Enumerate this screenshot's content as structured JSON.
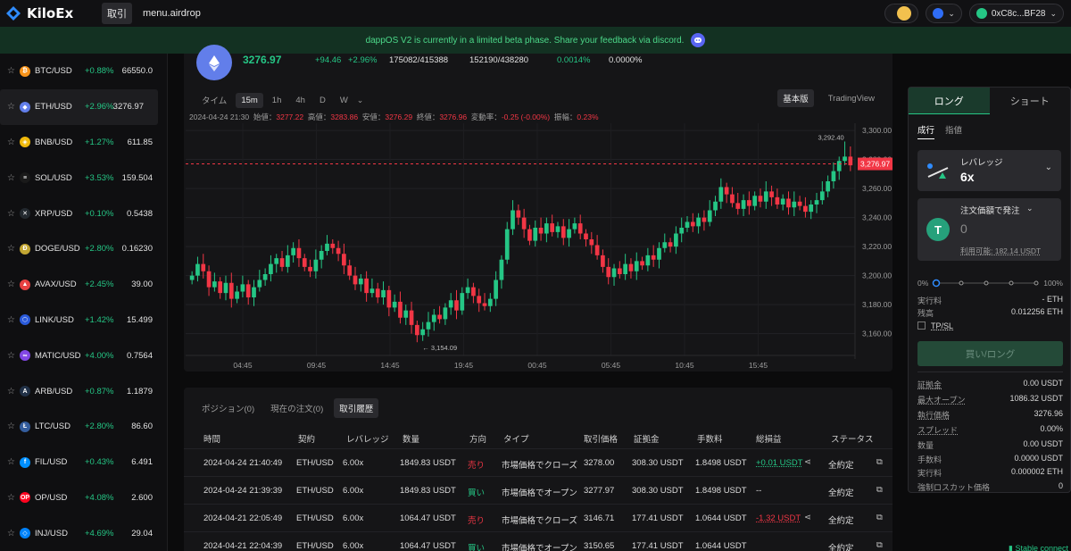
{
  "header": {
    "logo": "KiloEx",
    "nav_active": "取引",
    "nav_link": "menu.airdrop",
    "wallet": "0xC8c...BF28"
  },
  "banner": {
    "text": "dappOS V2 is currently in a limited beta phase. Share your feedback via discord."
  },
  "markets": [
    {
      "pair": "BTC/USD",
      "change": "+0.88%",
      "price": "66550.0",
      "color": "#f7931a",
      "glyph": "₿"
    },
    {
      "pair": "ETH/USD",
      "change": "+2.96%",
      "price": "3276.97",
      "color": "#627eea",
      "glyph": "◆"
    },
    {
      "pair": "BNB/USD",
      "change": "+1.27%",
      "price": "611.85",
      "color": "#f0b90b",
      "glyph": "◈"
    },
    {
      "pair": "SOL/USD",
      "change": "+3.53%",
      "price": "159.504",
      "color": "#1a1a1a",
      "glyph": "≡"
    },
    {
      "pair": "XRP/USD",
      "change": "+0.10%",
      "price": "0.5438",
      "color": "#23292f",
      "glyph": "✕"
    },
    {
      "pair": "DOGE/USD",
      "change": "+2.80%",
      "price": "0.16230",
      "color": "#c2a633",
      "glyph": "Ð"
    },
    {
      "pair": "AVAX/USD",
      "change": "+2.45%",
      "price": "39.00",
      "color": "#e84142",
      "glyph": "▲"
    },
    {
      "pair": "LINK/USD",
      "change": "+1.42%",
      "price": "15.499",
      "color": "#2a5ada",
      "glyph": "⬡"
    },
    {
      "pair": "MATIC/USD",
      "change": "+4.00%",
      "price": "0.7564",
      "color": "#8247e5",
      "glyph": "∞"
    },
    {
      "pair": "ARB/USD",
      "change": "+0.87%",
      "price": "1.1879",
      "color": "#213147",
      "glyph": "A"
    },
    {
      "pair": "LTC/USD",
      "change": "+2.80%",
      "price": "86.60",
      "color": "#345d9d",
      "glyph": "Ł"
    },
    {
      "pair": "FIL/USD",
      "change": "+0.43%",
      "price": "6.491",
      "color": "#0090ff",
      "glyph": "f"
    },
    {
      "pair": "OP/USD",
      "change": "+4.08%",
      "price": "2.600",
      "color": "#ff0420",
      "glyph": "OP"
    },
    {
      "pair": "INJ/USD",
      "change": "+4.69%",
      "price": "29.04",
      "color": "#0082fa",
      "glyph": "◇"
    }
  ],
  "ticker": {
    "price": "3276.97",
    "change_abs": "+94.46",
    "change_pct": "+2.96%",
    "oi_long": "175082/415388",
    "oi_short": "152190/438280",
    "funding": "0.0014%",
    "borrow": "0.0000%"
  },
  "chart_toolbar": {
    "intervals": [
      "タイム",
      "15m",
      "1h",
      "4h",
      "D",
      "W"
    ],
    "mode_basic": "基本版",
    "mode_tv": "TradingView"
  },
  "ohlc": {
    "time": "2024-04-24 21:30",
    "open_label": "始値：",
    "open": "3277.22",
    "high_label": "高値：",
    "high": "3283.86",
    "low_label": "安値：",
    "low": "3276.29",
    "close_label": "終値：",
    "close": "3276.96",
    "chg_label": "変動率：",
    "chg": "-0.25 (-0.00%)",
    "amp_label": "振幅：",
    "amp": "0.23%"
  },
  "chart_data": {
    "type": "candlestick",
    "ylim": [
      3145,
      3305
    ],
    "y_ticks": [
      "3,300.00",
      "3,280.00",
      "3,260.00",
      "3,240.00",
      "3,220.00",
      "3,200.00",
      "3,180.00",
      "3,160.00"
    ],
    "x_ticks": [
      "04:45",
      "09:45",
      "14:45",
      "19:45",
      "00:45",
      "05:45",
      "10:45",
      "15:45"
    ],
    "current_price_label": "3,276.97",
    "current_price": 3276.97,
    "high_marker": "3,292.40",
    "high_value": 3292.4,
    "low_marker": "3,154.09",
    "low_value": 3154.09,
    "closes": [
      3200,
      3208,
      3203,
      3192,
      3196,
      3188,
      3195,
      3184,
      3189,
      3194,
      3185,
      3192,
      3197,
      3201,
      3208,
      3212,
      3206,
      3214,
      3219,
      3212,
      3206,
      3203,
      3211,
      3217,
      3222,
      3219,
      3215,
      3207,
      3200,
      3194,
      3198,
      3188,
      3191,
      3185,
      3190,
      3178,
      3182,
      3171,
      3176,
      3166,
      3159,
      3163,
      3168,
      3173,
      3170,
      3178,
      3183,
      3176,
      3188,
      3192,
      3186,
      3181,
      3179,
      3184,
      3197,
      3211,
      3232,
      3245,
      3240,
      3232,
      3224,
      3233,
      3229,
      3236,
      3230,
      3234,
      3226,
      3232,
      3236,
      3229,
      3225,
      3221,
      3214,
      3206,
      3199,
      3205,
      3201,
      3208,
      3203,
      3210,
      3207,
      3214,
      3211,
      3219,
      3223,
      3220,
      3229,
      3233,
      3237,
      3234,
      3240,
      3237,
      3245,
      3251,
      3261,
      3256,
      3250,
      3246,
      3252,
      3248,
      3255,
      3251,
      3258,
      3254,
      3249,
      3253,
      3247,
      3251,
      3248,
      3244,
      3249,
      3252,
      3258,
      3265,
      3272,
      3279,
      3282,
      3276
    ]
  },
  "orders": {
    "tabs": [
      "ポジション(0)",
      "現在の注文(0)",
      "取引履歴"
    ],
    "columns": [
      "時間",
      "契約",
      "レバレッジ",
      "数量",
      "方向",
      "タイプ",
      "取引価格",
      "証拠金",
      "手数料",
      "総損益",
      "ステータス"
    ],
    "rows": [
      {
        "time": "2024-04-24 21:40:49",
        "contract": "ETH/USD",
        "lev": "6.00x",
        "qty": "1849.83 USDT",
        "side": "売り",
        "dir": "sell",
        "type": "市場価格でクローズ",
        "price": "3278.00",
        "margin": "308.30 USDT",
        "fee": "1.8498 USDT",
        "pnl": "+0.01 USDT",
        "pnl_sign": "pos",
        "status": "全約定"
      },
      {
        "time": "2024-04-24 21:39:39",
        "contract": "ETH/USD",
        "lev": "6.00x",
        "qty": "1849.83 USDT",
        "side": "買い",
        "dir": "buy",
        "type": "市場価格でオープン",
        "price": "3277.97",
        "margin": "308.30 USDT",
        "fee": "1.8498 USDT",
        "pnl": "--",
        "pnl_sign": "none",
        "status": "全約定"
      },
      {
        "time": "2024-04-21 22:05:49",
        "contract": "ETH/USD",
        "lev": "6.00x",
        "qty": "1064.47 USDT",
        "side": "売り",
        "dir": "sell",
        "type": "市場価格でクローズ",
        "price": "3146.71",
        "margin": "177.41 USDT",
        "fee": "1.0644 USDT",
        "pnl": "-1.32 USDT",
        "pnl_sign": "neg",
        "status": "全約定"
      },
      {
        "time": "2024-04-21 22:04:39",
        "contract": "ETH/USD",
        "lev": "6.00x",
        "qty": "1064.47 USDT",
        "side": "買い",
        "dir": "buy",
        "type": "市場価格でオープン",
        "price": "3150.65",
        "margin": "177.41 USDT",
        "fee": "1.0644 USDT",
        "pnl": "",
        "pnl_sign": "none",
        "status": "全約定"
      }
    ]
  },
  "trade": {
    "long": "ロング",
    "short": "ショート",
    "market": "成行",
    "limit": "指値",
    "leverage_label": "レバレッジ",
    "leverage_value": "6x",
    "amount_label": "注文価額で発注",
    "amount_value": "0",
    "available": "利用可能: 182.14 USDT",
    "slider_min": "0%",
    "slider_max": "100%",
    "slider_level": 0,
    "exec_fee_label": "実行料",
    "exec_fee": "- ETH",
    "balance_label": "残高",
    "balance": "0.012256 ETH",
    "tpsl": "TP/SL",
    "cta": "買い/ロング",
    "margin_label": "証拠金",
    "margin": "0.00 USDT",
    "max_open_label": "最大オープン",
    "max_open": "1086.32 USDT",
    "exec_price_label": "執行価格",
    "exec_price": "3276.96",
    "spread_label": "スプレッド",
    "spread": "0.00%",
    "qty_label": "数量",
    "qty": "0.00 USDT",
    "fee_label": "手数料",
    "fee": "0.0000 USDT",
    "exec_fee2_label": "実行料",
    "exec_fee2": "0.000002 ETH",
    "liq_label": "強制ロスカット価格",
    "liq": "0"
  },
  "footer": {
    "stable": "Stable connect"
  },
  "colors": {
    "up": "#25c685",
    "down": "#f23645",
    "accent": "#1a3a2c"
  }
}
